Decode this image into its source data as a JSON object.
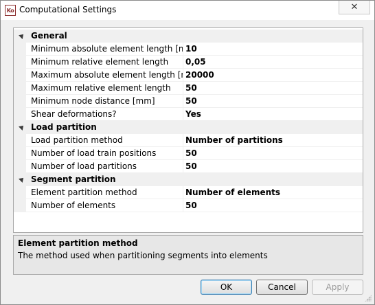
{
  "window": {
    "title": "Computational Settings",
    "icon_text": "Ko",
    "close_glyph": "✕"
  },
  "grid": {
    "categories": [
      {
        "label": "General",
        "properties": [
          {
            "name": "Minimum absolute element length [mm]",
            "value": "10"
          },
          {
            "name": "Minimum relative element length",
            "value": "0,05"
          },
          {
            "name": "Maximum absolute element length [mm]",
            "value": "20000"
          },
          {
            "name": "Maximum relative element length",
            "value": "50"
          },
          {
            "name": "Minimum node distance [mm]",
            "value": "50"
          },
          {
            "name": "Shear deformations?",
            "value": "Yes"
          }
        ]
      },
      {
        "label": "Load partition",
        "properties": [
          {
            "name": "Load partition method",
            "value": "Number of partitions"
          },
          {
            "name": "Number of load train positions",
            "value": "50"
          },
          {
            "name": "Number of load partitions",
            "value": "50"
          }
        ]
      },
      {
        "label": "Segment partition",
        "properties": [
          {
            "name": "Element partition method",
            "value": "Number of elements"
          },
          {
            "name": "Number of elements",
            "value": "50"
          }
        ]
      }
    ]
  },
  "description": {
    "title": "Element partition method",
    "text": "The method used when partitioning segments into elements"
  },
  "buttons": {
    "ok": "OK",
    "cancel": "Cancel",
    "apply": "Apply"
  }
}
